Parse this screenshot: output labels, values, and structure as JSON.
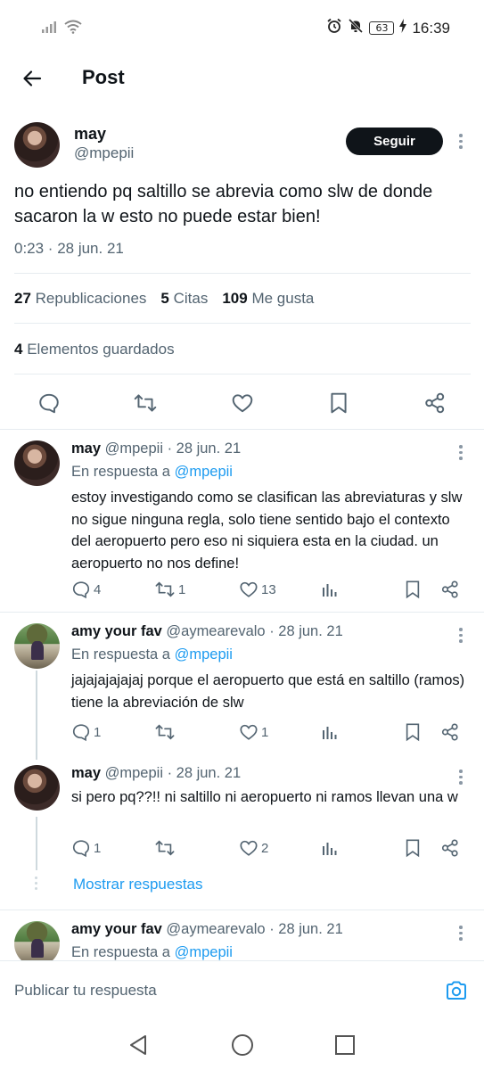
{
  "status_bar": {
    "time": "16:39",
    "battery": "63",
    "icons": [
      "signal-icon",
      "wifi-icon",
      "alarm-icon",
      "mute-icon",
      "battery-icon",
      "charging-icon"
    ]
  },
  "header": {
    "title": "Post"
  },
  "post": {
    "author_name": "may",
    "author_handle": "@mpepii",
    "follow_label": "Seguir",
    "text": "no entiendo pq saltillo se abrevia como slw de donde sacaron la w esto no puede estar bien!",
    "meta": "0:23 · 28 jun. 21",
    "stats": {
      "reposts_count": "27",
      "reposts_label": "Republicaciones",
      "quotes_count": "5",
      "quotes_label": "Citas",
      "likes_count": "109",
      "likes_label": "Me gusta"
    },
    "saved": {
      "count": "4",
      "label": "Elementos guardados"
    }
  },
  "replies": [
    {
      "name": "may",
      "handle_date": "@mpepii · 28 jun. 21",
      "in_reply_prefix": "En respuesta a",
      "in_reply_to": "@mpepii",
      "text": "estoy investigando como se clasifican las abreviaturas y slw no sigue ninguna regla, solo tiene sentido bajo el contexto del aeropuerto pero eso ni siquiera esta en la ciudad. un aeropuerto no nos define!",
      "comments": "4",
      "reposts": "1",
      "likes": "13"
    },
    {
      "name": "amy your fav",
      "handle_date": "@aymearevalo · 28 jun. 21",
      "in_reply_prefix": "En respuesta a",
      "in_reply_to": "@mpepii",
      "text": "jajajajajajaj porque el aeropuerto que está en saltillo (ramos) tiene la abreviación de slw",
      "comments": "1",
      "reposts": "",
      "likes": "1"
    },
    {
      "name": "may",
      "handle_date": "@mpepii · 28 jun. 21",
      "text": "si pero pq??!! ni saltillo ni aeropuerto ni ramos llevan una w",
      "comments": "1",
      "reposts": "",
      "likes": "2"
    },
    {
      "name": "amy your fav",
      "handle_date": "@aymearevalo · 28 jun. 21",
      "in_reply_prefix": "En respuesta a",
      "in_reply_to": "@mpepii"
    }
  ],
  "show_replies_label": "Mostrar respuestas",
  "reply_bar": {
    "placeholder": "Publicar tu respuesta"
  },
  "colors": {
    "accent": "#1d9bf0",
    "text": "#0f1419",
    "secondary": "#536471",
    "divider": "#e6ecf0"
  }
}
